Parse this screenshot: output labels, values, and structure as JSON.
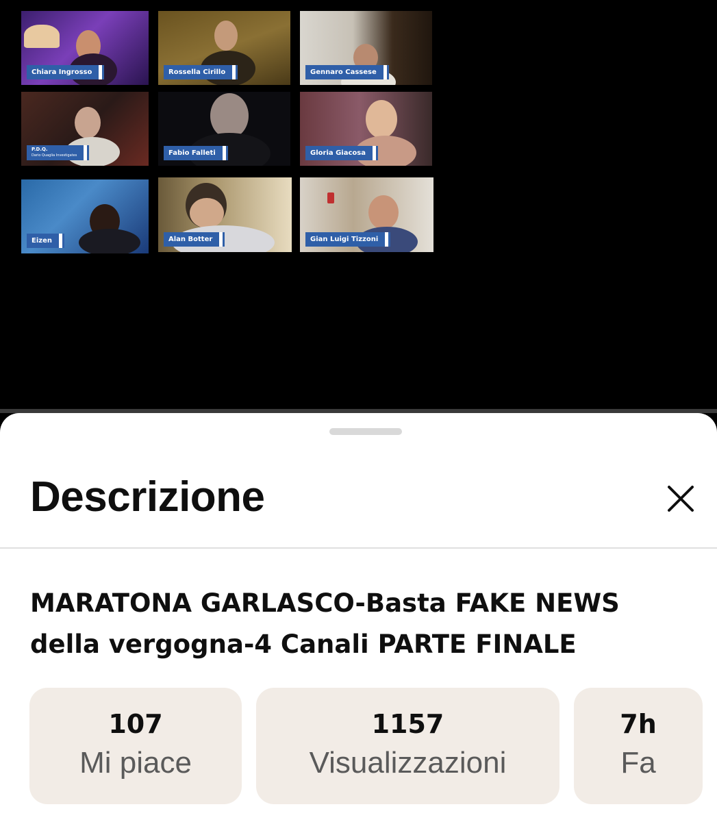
{
  "participants": [
    {
      "name": "Chiara Ingrosso"
    },
    {
      "name": "Rossella Cirillo"
    },
    {
      "name": "Gennaro Cassese"
    },
    {
      "name": "P.D.Q.",
      "subtitle": "Dario Quaglia Investigates"
    },
    {
      "name": "Fabio Falleti"
    },
    {
      "name": "Gloria Giacosa"
    },
    {
      "name": "Eizen"
    },
    {
      "name": "Alan Botter"
    },
    {
      "name": "Gian Luigi Tizzoni"
    }
  ],
  "sheet": {
    "title": "Descrizione",
    "video_title": "MARATONA GARLASCO-Basta FAKE NEWS della vergogna-4 Canali PARTE FINALE"
  },
  "stats": [
    {
      "value": "107",
      "label": "Mi piace"
    },
    {
      "value": "1157",
      "label": "Visualizzazioni"
    },
    {
      "value": "7h",
      "label": "Fa"
    }
  ],
  "icons": {
    "close": "close-icon"
  },
  "colors": {
    "name_tag": "#2f5fa8",
    "stat_bg": "#f2ece6"
  }
}
